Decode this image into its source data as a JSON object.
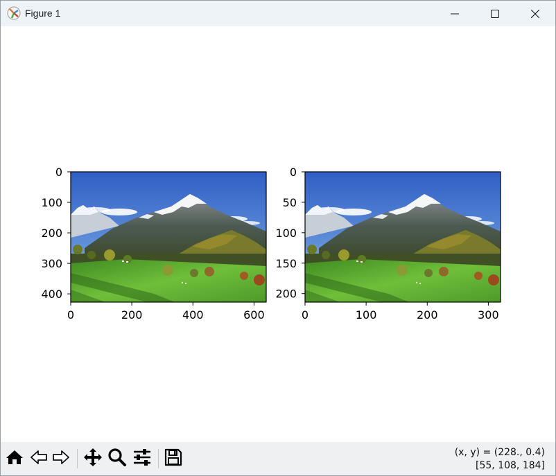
{
  "window": {
    "title": "Figure 1",
    "app_icon": "matplotlib-icon",
    "controls": [
      "minimize-icon",
      "maximize-icon",
      "close-icon"
    ]
  },
  "figure": {
    "subplots": [
      {
        "name": "original-image",
        "image_size": {
          "width": 640,
          "height": 427
        },
        "x_ticks": [
          "0",
          "200",
          "400",
          "600"
        ],
        "y_ticks": [
          "0",
          "100",
          "200",
          "300",
          "400"
        ]
      },
      {
        "name": "downsampled-image",
        "image_size": {
          "width": 320,
          "height": 214
        },
        "x_ticks": [
          "0",
          "100",
          "200",
          "300"
        ],
        "y_ticks": [
          "0",
          "50",
          "100",
          "150",
          "200"
        ]
      }
    ]
  },
  "toolbar": {
    "tools": [
      {
        "name": "home-icon"
      },
      {
        "name": "back-icon"
      },
      {
        "name": "forward-icon"
      },
      {
        "name": "pan-icon"
      },
      {
        "name": "zoom-icon"
      },
      {
        "name": "configure-subplots-icon"
      },
      {
        "name": "save-icon"
      }
    ],
    "status_line1": "(x, y) = (228., 0.4)",
    "status_line2": "[55, 108, 184]"
  },
  "colors": {
    "sky_top": "#2f5fc4",
    "sky_bottom": "#a8c8ec",
    "mountain": "#4f5a63",
    "snow": "#eef2f6",
    "forest": "#4a5a26",
    "meadow": "#5aa832",
    "toolbar_bg": "#eef0f1",
    "titlebar_bg": "#eef3f8"
  }
}
